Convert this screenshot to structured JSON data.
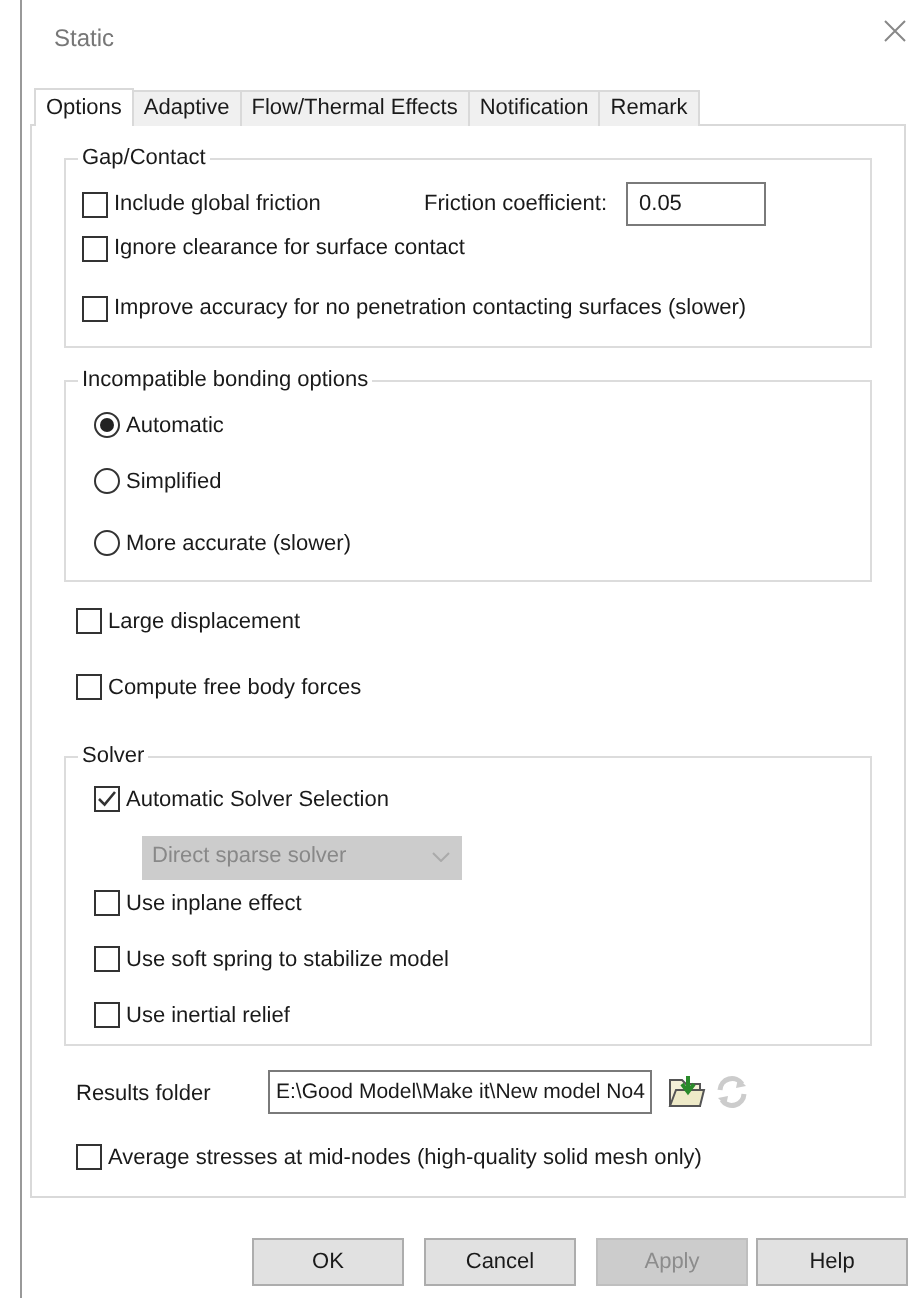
{
  "window": {
    "title": "Static"
  },
  "tabs": [
    {
      "label": "Options",
      "selected": true
    },
    {
      "label": "Adaptive",
      "selected": false
    },
    {
      "label": "Flow/Thermal Effects",
      "selected": false
    },
    {
      "label": "Notification",
      "selected": false
    },
    {
      "label": "Remark",
      "selected": false
    }
  ],
  "gap_contact": {
    "title": "Gap/Contact",
    "items": [
      {
        "label": "Include global friction",
        "checked": false
      },
      {
        "label": "Ignore clearance for surface contact",
        "checked": false
      },
      {
        "label": "Improve accuracy for no penetration contacting surfaces (slower)",
        "checked": false
      }
    ],
    "friction": {
      "label": "Friction coefficient:",
      "value": "0.05"
    }
  },
  "bonding": {
    "title": "Incompatible bonding options",
    "options": [
      {
        "label": "Automatic",
        "selected": true
      },
      {
        "label": "Simplified",
        "selected": false
      },
      {
        "label": "More accurate (slower)",
        "selected": false
      }
    ]
  },
  "options": [
    {
      "label": "Large displacement",
      "checked": false
    },
    {
      "label": "Compute free body forces",
      "checked": false
    }
  ],
  "solver": {
    "title": "Solver",
    "auto": {
      "label": "Automatic Solver Selection",
      "checked": true
    },
    "dropdown": {
      "value": "Direct sparse solver",
      "disabled": true
    },
    "items": [
      {
        "label": "Use inplane effect",
        "checked": false
      },
      {
        "label": "Use soft spring to stabilize model",
        "checked": false
      },
      {
        "label": "Use inertial relief",
        "checked": false
      }
    ]
  },
  "results_folder": {
    "label": "Results folder",
    "value": "E:\\Good Model\\Make it\\New model No4"
  },
  "average": {
    "label": "Average stresses at mid-nodes (high-quality solid mesh only)",
    "checked": false
  },
  "buttons": [
    {
      "label": "OK",
      "disabled": false
    },
    {
      "label": "Cancel",
      "disabled": false
    },
    {
      "label": "Apply",
      "disabled": true
    },
    {
      "label": "Help",
      "disabled": false
    }
  ]
}
